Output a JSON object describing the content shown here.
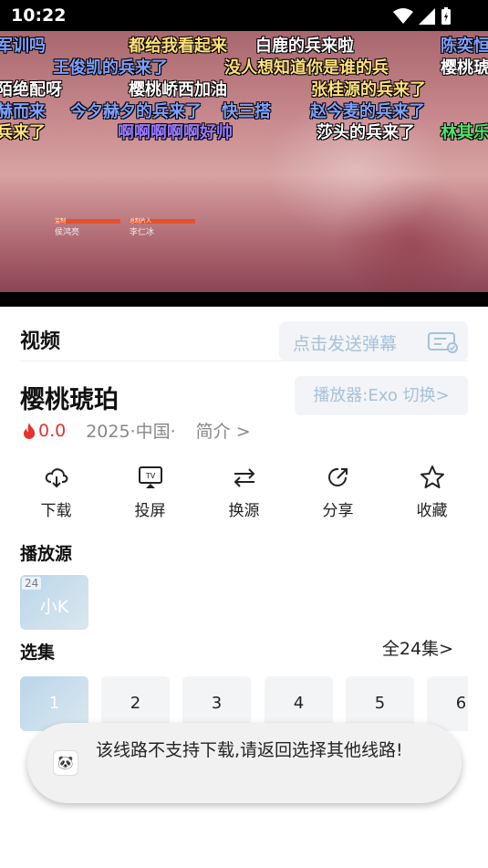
{
  "status_bar": {
    "time": "10:22"
  },
  "danmaku": [
    {
      "text": "军训吗",
      "color": "#7fa0ff"
    },
    {
      "text": "都给我看起来",
      "color": "#ffe27a"
    },
    {
      "text": "白鹿的兵来啦",
      "color": "#ffffff"
    },
    {
      "text": "陈奕恒",
      "color": "#7fa0ff"
    },
    {
      "text": "王俊凯的兵来了",
      "color": "#7fa0ff"
    },
    {
      "text": "没人想知道你是谁的兵",
      "color": "#ffe27a"
    },
    {
      "text": "樱桃琥",
      "color": "#ffffff"
    },
    {
      "text": "陌绝配呀",
      "color": "#ffffff"
    },
    {
      "text": "樱桃峤西加油",
      "color": "#ffffff"
    },
    {
      "text": "张桂源的兵来了",
      "color": "#ffe27a"
    },
    {
      "text": "赫而来",
      "color": "#7fa0ff"
    },
    {
      "text": "今夕赫夕的兵来了",
      "color": "#7fa0ff"
    },
    {
      "text": "快三搭",
      "color": "#7fa0ff"
    },
    {
      "text": "赵今麦的兵来了",
      "color": "#7fa0ff"
    },
    {
      "text": "兵来了",
      "color": "#ffe27a"
    },
    {
      "text": "啊啊啊啊啊好帅",
      "color": "#9a7bff"
    },
    {
      "text": "莎头的兵来了",
      "color": "#ffffff"
    },
    {
      "text": "林其乐",
      "color": "#4fe36a"
    }
  ],
  "video_credits": [
    {
      "role": "监制",
      "name": "侯鸿亮"
    },
    {
      "role": "总制片人",
      "name": "李仁冰"
    }
  ],
  "tabs": {
    "video": "视频"
  },
  "danmaku_input": {
    "placeholder": "点击发送弹幕"
  },
  "movie": {
    "title": "樱桃琥珀",
    "score": "0.0",
    "year_region": "2025·中国·",
    "intro_link": "简介 >"
  },
  "player_button": "播放器:Exo 切换>",
  "actions": [
    {
      "label": "下载",
      "icon": "download-icon"
    },
    {
      "label": "投屏",
      "icon": "tv-cast-icon"
    },
    {
      "label": "换源",
      "icon": "swap-icon"
    },
    {
      "label": "分享",
      "icon": "share-icon"
    },
    {
      "label": "收藏",
      "icon": "star-icon"
    }
  ],
  "source_section": {
    "title": "播放源",
    "sources": [
      {
        "name": "小K",
        "count": "24"
      }
    ]
  },
  "episode_section": {
    "title": "选集",
    "all_link": "全24集>",
    "episodes": [
      "1",
      "2",
      "3",
      "4",
      "5",
      "6"
    ],
    "selected": "1"
  },
  "toast": {
    "message": "该线路不支持下载,请返回选择其他线路!"
  },
  "colors": {
    "accent_light": "#a7c1d8",
    "score_red": "#e5322d",
    "chip_bg": "#f2f4f7"
  }
}
